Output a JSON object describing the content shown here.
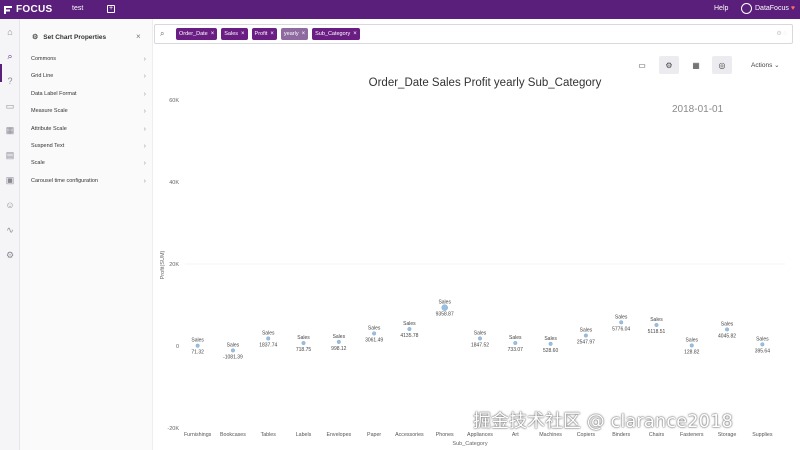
{
  "app": {
    "logo": "FOCUS",
    "tab_name": "test",
    "tab_add": "+",
    "help": "Help",
    "user_name": "DataFocus"
  },
  "panel": {
    "title": "Set Chart Properties",
    "items": [
      {
        "label": "Commons"
      },
      {
        "label": "Grid Line"
      },
      {
        "label": "Data Label Format"
      },
      {
        "label": "Measure Scale"
      },
      {
        "label": "Attribute Scale"
      },
      {
        "label": "Suspend Text"
      },
      {
        "label": "Scale"
      },
      {
        "label": "Carousel time configuration"
      }
    ]
  },
  "search": {
    "tokens": [
      {
        "label": "Order_Date",
        "style": "dark"
      },
      {
        "label": "Sales",
        "style": "dark"
      },
      {
        "label": "Profit",
        "style": "dark"
      },
      {
        "label": "yearly",
        "style": "light"
      },
      {
        "label": "Sub_Category",
        "style": "dark"
      }
    ]
  },
  "toolbar": {
    "actions_label": "Actions"
  },
  "colors": {
    "brand": "#5a1f7a",
    "token": "#6a1e83",
    "point": "#8fb7dd"
  },
  "chart_data": {
    "type": "scatter",
    "title": "Order_Date Sales Profit yearly Sub_Category",
    "animation_frame": "2018-01-01",
    "xlabel": "Sub_Category",
    "ylabel": "Profit(SUM)",
    "ylim": [
      -20000,
      60000
    ],
    "yticks": [
      {
        "v": 60000,
        "label": "60K"
      },
      {
        "v": 40000,
        "label": "40K"
      },
      {
        "v": 20000,
        "label": "20K"
      },
      {
        "v": 0,
        "label": "0"
      },
      {
        "v": -20000,
        "label": "-20K"
      }
    ],
    "series_label": "Sales",
    "categories": [
      "Furnishings",
      "Bookcases",
      "Tables",
      "Labels",
      "Envelopes",
      "Paper",
      "Accessories",
      "Phones",
      "Appliances",
      "Art",
      "Machines",
      "Copiers",
      "Binders",
      "Chairs",
      "Fasteners",
      "Storage",
      "Supplies"
    ],
    "values": [
      71.32,
      -1081.39,
      1837.74,
      718.75,
      998.12,
      3061.49,
      4135.78,
      9358.87,
      1847.52,
      733.07,
      528.6,
      2547.97,
      5776.04,
      5118.51,
      128.82,
      4045.82,
      395.64
    ],
    "value_labels": [
      "71.32",
      "-1081.39",
      "1837.74",
      "718.75",
      "998.12",
      "3061.49",
      "4135.78",
      "9358.87",
      "1847.52",
      "733.07",
      "528.60",
      "2547.97",
      "5776.04",
      "5118.51",
      "128.82",
      "4045.82",
      "395.64"
    ],
    "grid": true
  },
  "watermark": "掘金技术社区 @ clarance2018"
}
